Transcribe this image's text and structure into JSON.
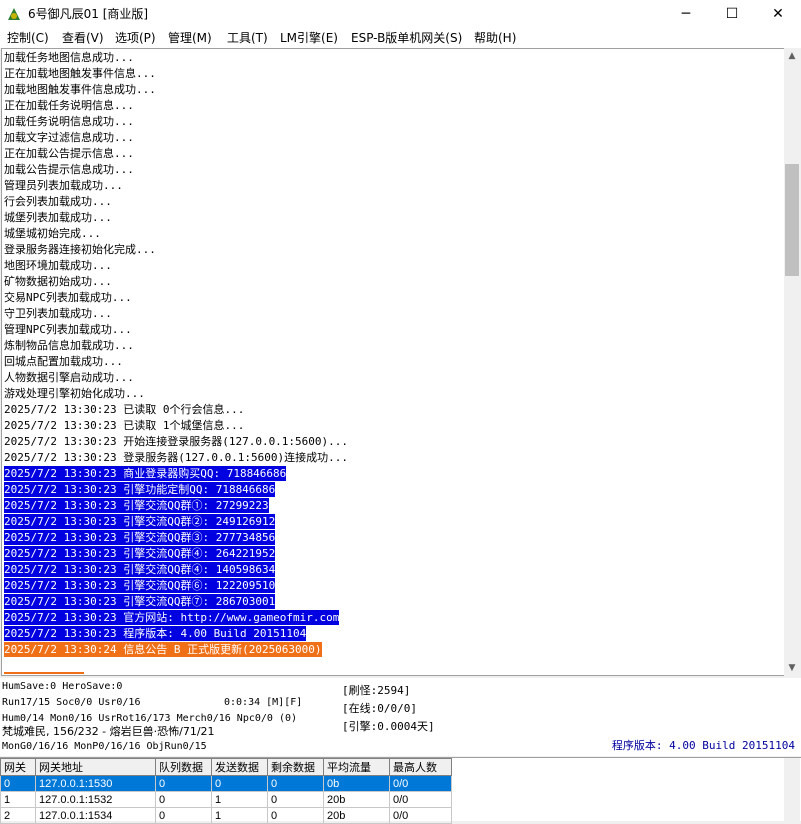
{
  "window": {
    "title": "6号御凡辰01 [商业版]",
    "controls": [
      "─",
      "☐",
      "✕"
    ]
  },
  "menu": [
    "控制(C)",
    "查看(V)",
    "选项(P)",
    "管理(M)",
    "工具(T)",
    "LM引擎(E)",
    "ESP-B版单机网关(S)",
    "帮助(H)"
  ],
  "log": [
    {
      "text": "加载任务地图信息成功...",
      "style": ""
    },
    {
      "text": "正在加载地图触发事件信息...",
      "style": ""
    },
    {
      "text": "加载地图触发事件信息成功...",
      "style": ""
    },
    {
      "text": "正在加载任务说明信息...",
      "style": ""
    },
    {
      "text": "加载任务说明信息成功...",
      "style": ""
    },
    {
      "text": "加载文字过滤信息成功...",
      "style": ""
    },
    {
      "text": "正在加载公告提示信息...",
      "style": ""
    },
    {
      "text": "加载公告提示信息成功...",
      "style": ""
    },
    {
      "text": "管理员列表加载成功...",
      "style": ""
    },
    {
      "text": "行会列表加载成功...",
      "style": ""
    },
    {
      "text": "城堡列表加载成功...",
      "style": ""
    },
    {
      "text": "城堡城初始完成...",
      "style": ""
    },
    {
      "text": "登录服务器连接初始化完成...",
      "style": ""
    },
    {
      "text": "地图环境加载成功...",
      "style": ""
    },
    {
      "text": "矿物数据初始成功...",
      "style": ""
    },
    {
      "text": "交易NPC列表加载成功...",
      "style": ""
    },
    {
      "text": "守卫列表加载成功...",
      "style": ""
    },
    {
      "text": "管理NPC列表加载成功...",
      "style": ""
    },
    {
      "text": "炼制物品信息加载成功...",
      "style": ""
    },
    {
      "text": "回城点配置加载成功...",
      "style": ""
    },
    {
      "text": "人物数据引擎启动成功...",
      "style": ""
    },
    {
      "text": "游戏处理引擎初始化成功...",
      "style": ""
    },
    {
      "text": "2025/7/2 13:30:23 已读取 0个行会信息...",
      "style": ""
    },
    {
      "text": "2025/7/2 13:30:23 已读取 1个城堡信息...",
      "style": ""
    },
    {
      "text": "2025/7/2 13:30:23 开始连接登录服务器(127.0.0.1:5600)...",
      "style": ""
    },
    {
      "text": "2025/7/2 13:30:23 登录服务器(127.0.0.1:5600)连接成功...",
      "style": ""
    },
    {
      "text": "2025/7/2 13:30:23 商业登录器购买QQ: 718846686",
      "style": "sel"
    },
    {
      "text": "2025/7/2 13:30:23 引擎功能定制QQ: 718846686",
      "style": "sel"
    },
    {
      "text": "2025/7/2 13:30:23 引擎交流QQ群①: 27299223",
      "style": "sel"
    },
    {
      "text": "2025/7/2 13:30:23 引擎交流QQ群②: 249126912",
      "style": "sel"
    },
    {
      "text": "2025/7/2 13:30:23 引擎交流QQ群③: 277734856",
      "style": "sel"
    },
    {
      "text": "2025/7/2 13:30:23 引擎交流QQ群④: 264221952",
      "style": "sel"
    },
    {
      "text": "2025/7/2 13:30:23 引擎交流QQ群④: 140598634",
      "style": "sel"
    },
    {
      "text": "2025/7/2 13:30:23 引擎交流QQ群⑥: 122209510",
      "style": "sel"
    },
    {
      "text": "2025/7/2 13:30:23 引擎交流QQ群⑦: 286703001",
      "style": "sel"
    },
    {
      "text": "2025/7/2 13:30:23 官方网站: http://www.gameofmir.com",
      "style": "sel"
    },
    {
      "text": "2025/7/2 13:30:23 程序版本: 4.00 Build 20151104",
      "style": "sel"
    },
    {
      "text": "2025/7/2 13:30:24 信息公告 B 正式版更新(2025063000)",
      "style": "alert"
    }
  ],
  "status": {
    "line1": "HumSave:0 HeroSave:0",
    "line2a": "Run17/15 Soc0/0 Usr0/16",
    "line2b": "0:0:34 [M][F]",
    "line3": "Hum0/14 Mon0/16 UsrRot16/173 Merch0/16 Npc0/0 (0)",
    "line4": "梵城难民, 156/232 - 熔岩巨兽·恐怖/71/21",
    "line5": "MonG0/16/16 MonP0/16/16 ObjRun0/15",
    "refresh": "[刷怪:2594]",
    "online": "[在线:0/0/0]",
    "engine": "[引擎:0.0004天]",
    "version": "程序版本: 4.00 Build 20151104"
  },
  "grid": {
    "headers": [
      "网关",
      "网关地址",
      "队列数据",
      "发送数据",
      "剩余数据",
      "平均流量",
      "最高人数"
    ],
    "rows": [
      [
        "0",
        "127.0.0.1:1530",
        "0",
        "0",
        "0",
        "0b",
        "0/0"
      ],
      [
        "1",
        "127.0.0.1:1532",
        "0",
        "1",
        "0",
        "20b",
        "0/0"
      ],
      [
        "2",
        "127.0.0.1:1534",
        "0",
        "1",
        "0",
        "20b",
        "0/0"
      ]
    ]
  }
}
